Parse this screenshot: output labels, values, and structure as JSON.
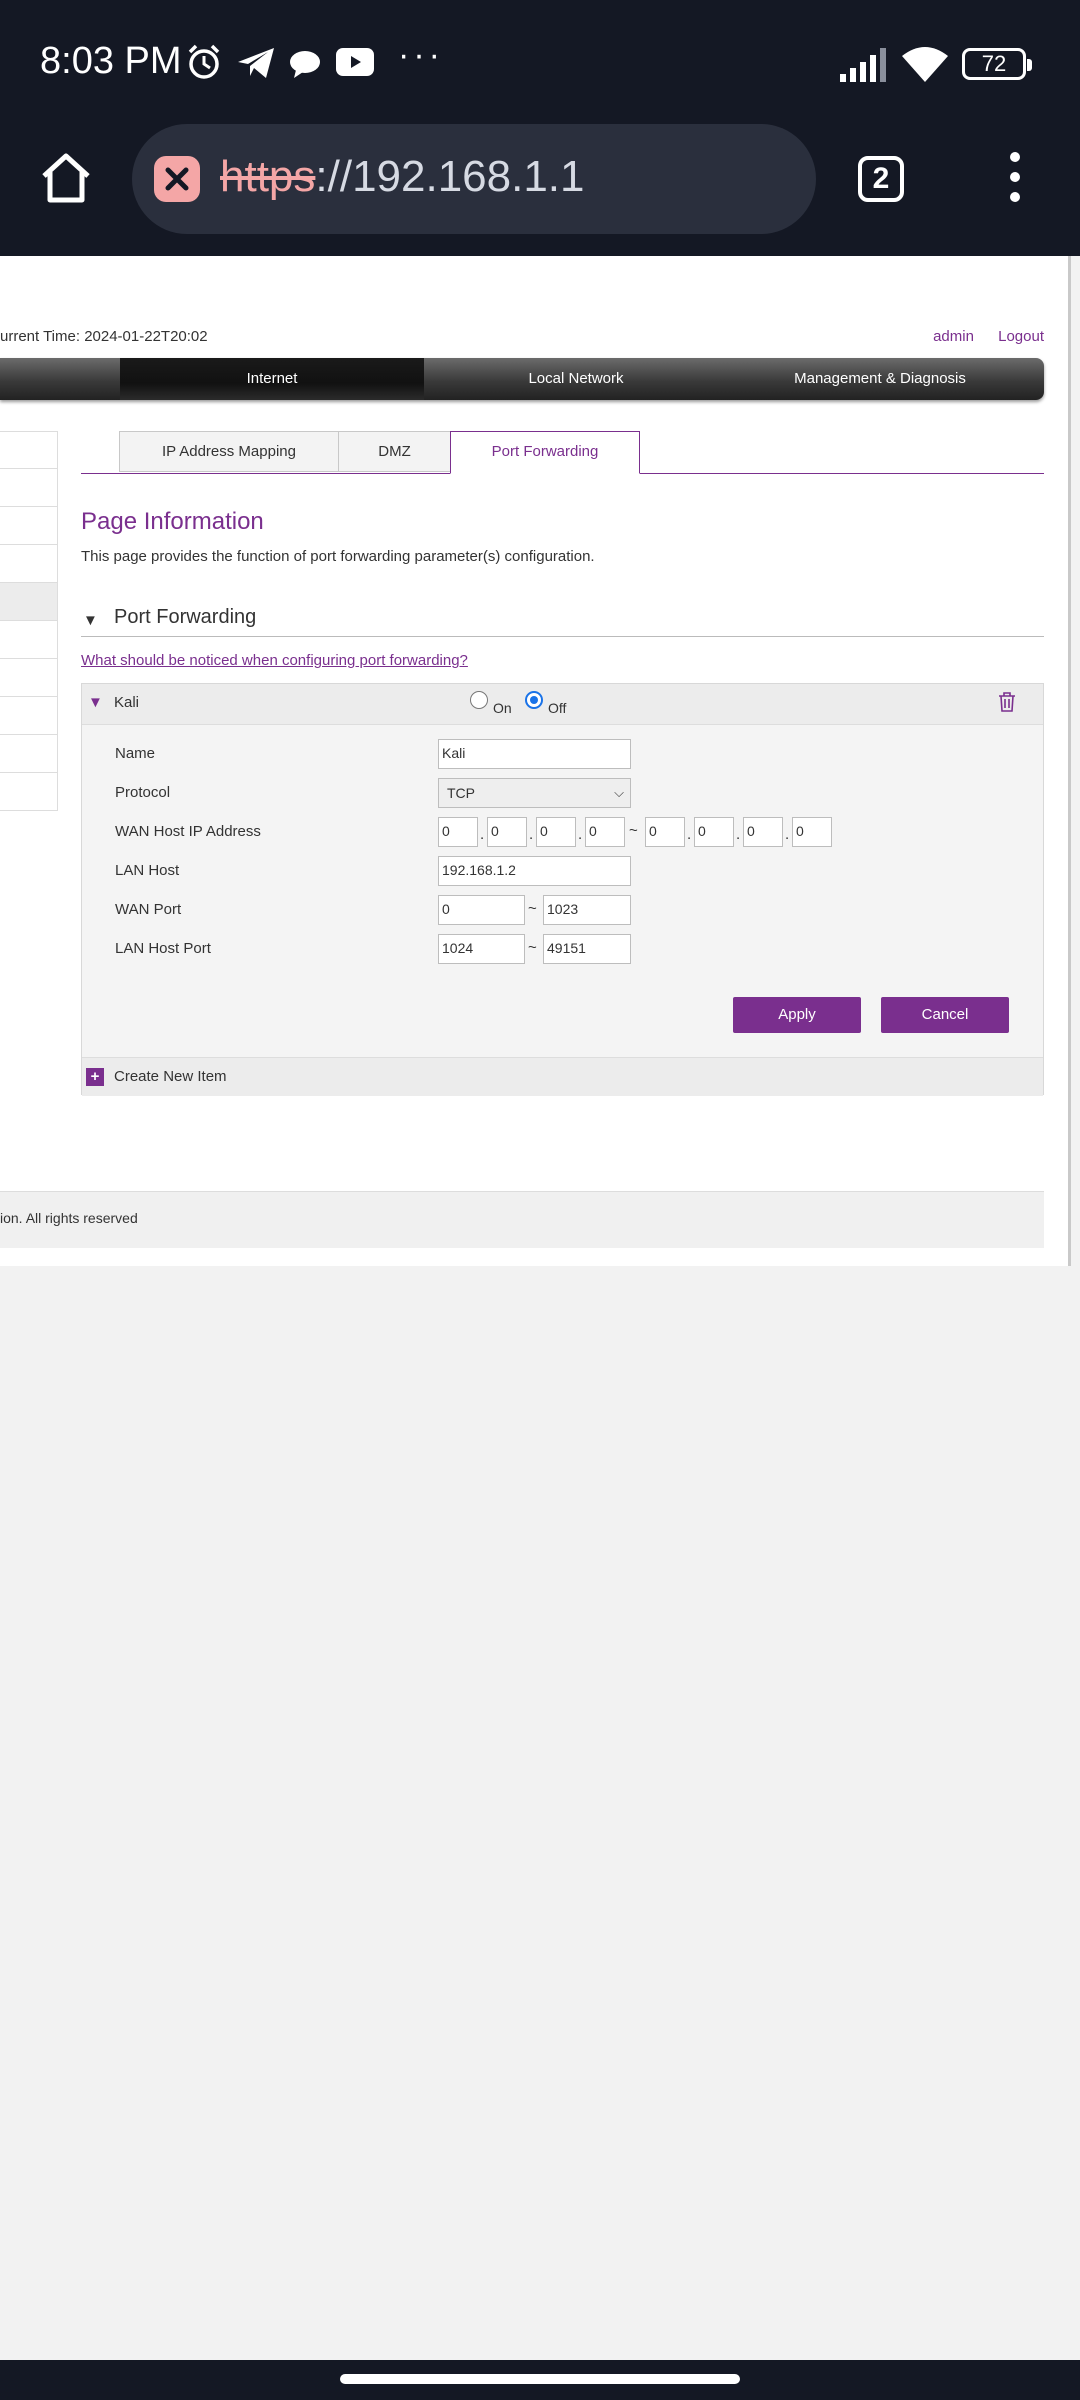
{
  "status_bar": {
    "time": "8:03 PM",
    "icons": [
      "alarm-icon",
      "telegram-icon",
      "chat-icon",
      "youtube-icon",
      "more-notifications-icon",
      "signal-icon",
      "wifi-icon",
      "battery-icon"
    ],
    "more": "···",
    "battery": "72"
  },
  "browser": {
    "url_scheme": "https",
    "url_rest": "://192.168.1.1",
    "tab_count": "2"
  },
  "header": {
    "current_time": "urrent Time: 2024-01-22T20:02",
    "user": "admin",
    "logout": "Logout"
  },
  "nav": {
    "items": [
      {
        "label": "Internet",
        "active": true
      },
      {
        "label": "Local Network",
        "active": false
      },
      {
        "label": "Management & Diagnosis",
        "active": false
      }
    ]
  },
  "subtabs": [
    {
      "label": "IP Address Mapping",
      "active": false
    },
    {
      "label": "DMZ",
      "active": false
    },
    {
      "label": "Port Forwarding",
      "active": true
    }
  ],
  "page_info": {
    "title": "Page Information",
    "description": "This page provides the function of port forwarding parameter(s) configuration."
  },
  "section": {
    "title": "Port Forwarding",
    "notice_link": "What should be noticed when configuring port forwarding?"
  },
  "item": {
    "name": "Kali",
    "on_label": "On",
    "off_label": "Off",
    "selected": "Off",
    "labels": {
      "name": "Name",
      "protocol": "Protocol",
      "wan_host_ip": "WAN Host IP Address",
      "lan_host": "LAN Host",
      "wan_port": "WAN Port",
      "lan_host_port": "LAN Host Port"
    },
    "values": {
      "name": "Kali",
      "protocol": "TCP",
      "wan_ip_start": [
        "0",
        "0",
        "0",
        "0"
      ],
      "wan_ip_end": [
        "0",
        "0",
        "0",
        "0"
      ],
      "lan_host": "192.168.1.2",
      "wan_port_start": "0",
      "wan_port_end": "1023",
      "lan_port_start": "1024",
      "lan_port_end": "49151"
    },
    "tilde": "~",
    "dot": ".",
    "apply": "Apply",
    "cancel": "Cancel"
  },
  "create_new": "Create New Item",
  "footer": "ion. All rights reserved",
  "colors": {
    "accent": "#7a2f8e",
    "status_bar_bg": "#141824",
    "page_bg": "#f2f2f2"
  }
}
